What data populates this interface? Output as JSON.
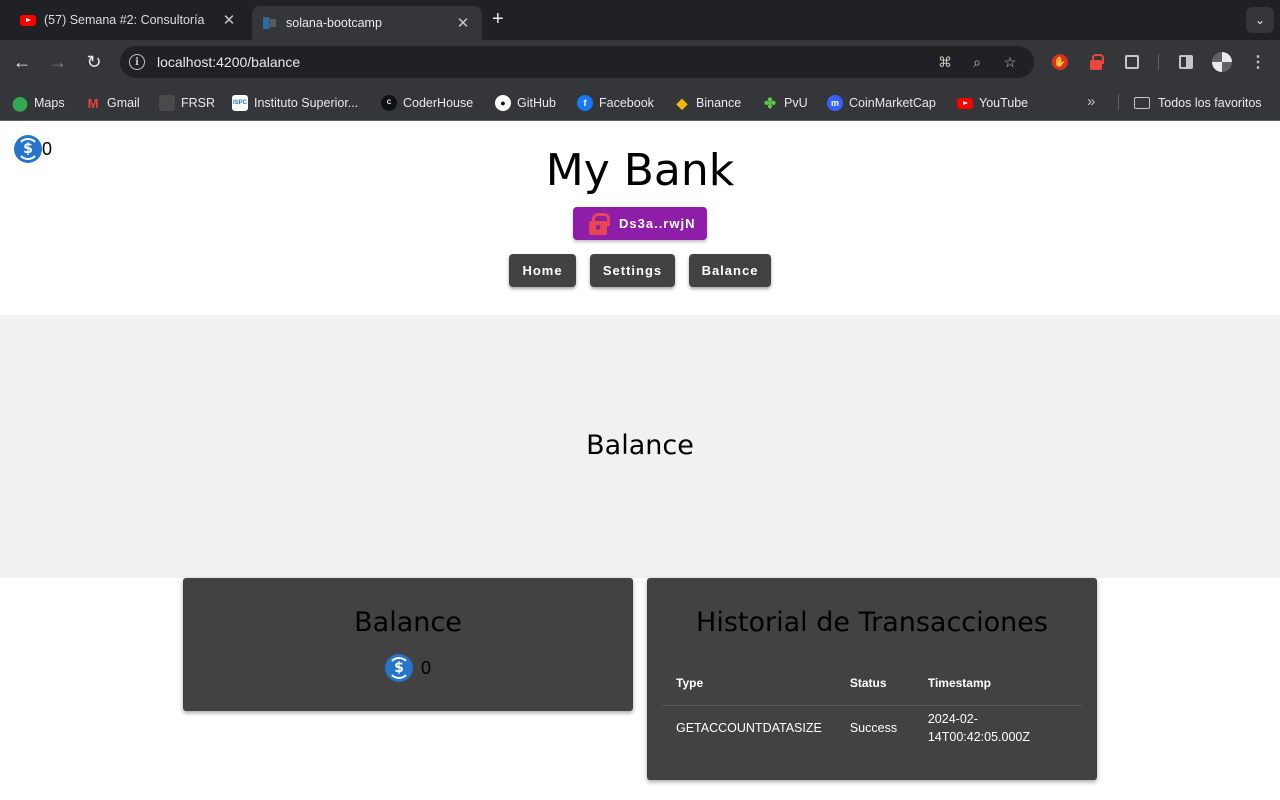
{
  "browser": {
    "tabs": [
      {
        "title": "(57) Semana #2: Consultoría",
        "favicon": "youtube-icon",
        "active": false
      },
      {
        "title": "solana-bootcamp",
        "favicon": "angular-icon",
        "active": true
      }
    ],
    "url": "localhost:4200/balance",
    "bookmarks": [
      {
        "label": "Maps",
        "icon": "maps-icon",
        "color": "#34a853"
      },
      {
        "label": "Gmail",
        "icon": "gmail-icon",
        "color": "#ea4335"
      },
      {
        "label": "FRSR",
        "icon": "frsr-icon",
        "color": "#4a4a4a"
      },
      {
        "label": "Instituto Superior...",
        "icon": "ispc-icon",
        "color": "#ffffff"
      },
      {
        "label": "CoderHouse",
        "icon": "coderhouse-icon",
        "color": "#111111"
      },
      {
        "label": "GitHub",
        "icon": "github-icon",
        "color": "#ffffff"
      },
      {
        "label": "Facebook",
        "icon": "facebook-icon",
        "color": "#1877f2"
      },
      {
        "label": "Binance",
        "icon": "binance-icon",
        "color": "#f0b90b"
      },
      {
        "label": "PvU",
        "icon": "pvu-icon",
        "color": "#5cc94a"
      },
      {
        "label": "CoinMarketCap",
        "icon": "coinmarketcap-icon",
        "color": "#3861fb"
      },
      {
        "label": "YouTube",
        "icon": "youtube-icon",
        "color": "#ff0000"
      }
    ],
    "all_bookmarks": "Todos los favoritos"
  },
  "app": {
    "wallet_balance": "0",
    "title": "My Bank",
    "wallet_address": "Ds3a..rwjN",
    "nav": {
      "home": "Home",
      "settings": "Settings",
      "balance": "Balance"
    },
    "hero_title": "Balance",
    "balance_card": {
      "title": "Balance",
      "amount": "0"
    },
    "history_card": {
      "title": "Historial de Transacciones",
      "columns": [
        "Type",
        "Status",
        "Timestamp"
      ],
      "rows": [
        {
          "type": "GETACCOUNTDATASIZE",
          "status": "Success",
          "timestamp_line1": "2024-02-",
          "timestamp_line2": "14T00:42:05.000Z"
        }
      ]
    }
  },
  "colors": {
    "wallet_button": "#8e1ea8",
    "nav_button": "#424242",
    "card": "#424242",
    "usdc": "#2775ca"
  }
}
